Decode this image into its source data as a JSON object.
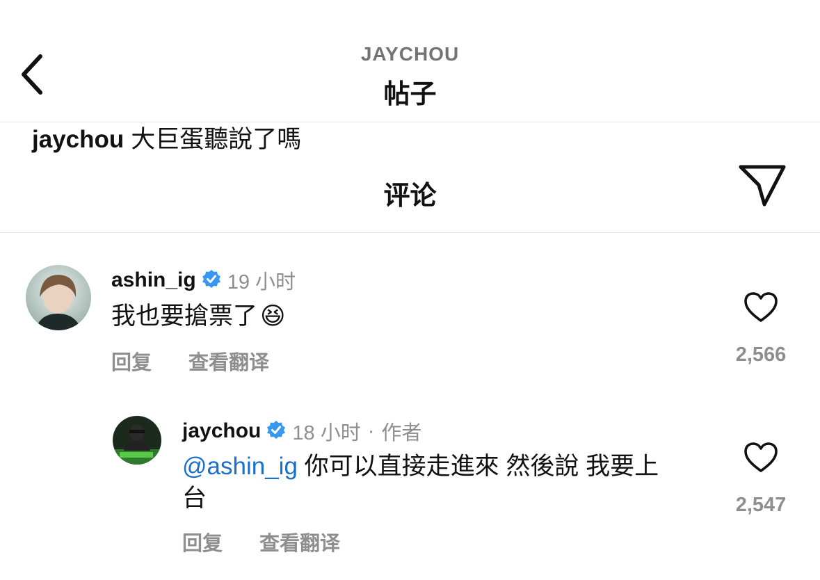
{
  "header": {
    "account": "JAYCHOU",
    "title": "帖子"
  },
  "caption": {
    "username": "jaychou",
    "text": "大巨蛋聽說了嗎"
  },
  "comments_header": {
    "title": "评论"
  },
  "comments": [
    {
      "username": "ashin_ig",
      "verified": true,
      "time": "19 小时",
      "text": "我也要搶票了",
      "emoji": "😆",
      "reply_label": "回复",
      "translate_label": "查看翻译",
      "likes": "2,566"
    },
    {
      "username": "jaychou",
      "verified": true,
      "time": "18 小时",
      "separator": "·",
      "author_tag": "作者",
      "mention": "@ashin_ig",
      "text_line1": "你可以直接走進來 然後說 我要上",
      "text_line2": "台",
      "reply_label": "回复",
      "translate_label": "查看翻译",
      "likes": "2,547"
    }
  ],
  "colors": {
    "accent_link": "#1a6fc9",
    "verified_badge": "#3897f0",
    "muted_text": "#8e8e8e"
  }
}
